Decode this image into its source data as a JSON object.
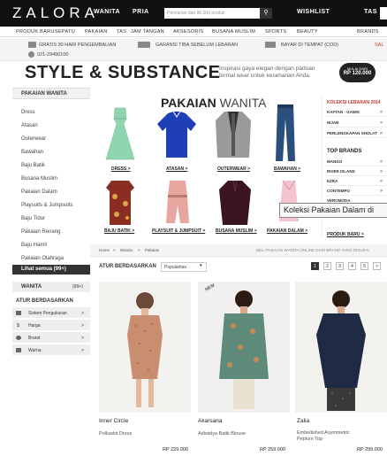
{
  "header": {
    "logo": "ZALORA",
    "nav": [
      "WANITA",
      "PRIA"
    ],
    "search_placeholder": "Pencarian dari 90.000 produk",
    "wishlist": "WISHLIST",
    "tas_short": "TAS"
  },
  "catnav": [
    "PRODUK BARU",
    "SEPATU",
    "PAKAIAN",
    "TAS",
    "JAM TANGAN",
    "AKSESORIS",
    "BUSANA MUSLIM",
    "SPORTS",
    "BEAUTY",
    "BRANDS"
  ],
  "benefits": {
    "free_return": "GRATIS 30 HARI PENGEMBALIAN",
    "phone": "021-29490100",
    "guarantee": "GARANSI TIBA SEBELUM LEBARAN",
    "cod": "BAYAR DI TEMPAT (COD)",
    "cut_right": "SAL"
  },
  "banner": {
    "title": "STYLE & SUBSTANCE",
    "subtitle": "Inspirasi gaya elegan dengan paduan formal wear untuk keseharian Anda.",
    "badge_top": "MULAI DARI",
    "badge_bottom": "RP 120.000"
  },
  "sidebar": {
    "heading": "PAKAIAN WANITA",
    "items": [
      "Dress",
      "Atasan",
      "Outerwear",
      "Bawahan",
      "Baju Batik",
      "Busana Muslim",
      "Pakaian Dalam",
      "Playsuits & Jumpsuits",
      "Baju Tidur",
      "Pakaian Renang",
      "Baju Hamil",
      "Pakaian Olahraga"
    ],
    "show_all": "Lihat semua (99+)",
    "wanita": "WANITA",
    "wanita_count": "(99+)",
    "filter_heading": "ATUR BERDASARKAN",
    "filters": [
      "Sistem Pengukuran",
      "Harga",
      "Brand",
      "Warna"
    ],
    "price_symbol": "$"
  },
  "main": {
    "title_bold": "PAKAIAN",
    "title_light": "WANITA",
    "categories": [
      "DRESS >",
      "ATASAN >",
      "OUTERWEAR >",
      "BAWAHAN >",
      "BAJU BATIK >",
      "PLAYSUIT & JUMPSUIT >",
      "BUSANA MUSLIM >",
      "PAKAIAN DALAM >"
    ],
    "tooltip": "Koleksi Pakaian Dalam di"
  },
  "right_panel": {
    "koleksi_title": "KOLEKSI LEBARAN 2014",
    "koleksi_links": [
      "KAFTAN - GAMIS",
      "HIJAB",
      "PERLENGKAPAN SHOLAT"
    ],
    "top_brands_title": "TOP BRANDS",
    "brands": [
      "MANGO",
      "RIVER ISLAND",
      "EZRA",
      "CONTEMPO",
      "VEROMODA"
    ],
    "produk_baru": "PRODUK BARU >",
    "arrow": ">"
  },
  "breadcrumb": {
    "items": [
      "Home",
      ">",
      "Wanita",
      ">",
      "Pakaian"
    ],
    "right_text": "BELI PAKAIAN WANITA ONLINE DARI BRAND YANG DISUKAI"
  },
  "sort": {
    "label": "ATUR BERDASARKAN",
    "value": "Popularitas",
    "caret": "▾",
    "pages": [
      "1",
      "2",
      "3",
      "4",
      "5",
      ">"
    ]
  },
  "products": [
    {
      "brand": "Inner Circle",
      "name": "Polkadot Dress",
      "price": "RP 229.000"
    },
    {
      "brand": "Akarsana",
      "name": "Adiwidya Batik Blouse",
      "price": "RP 259.000",
      "tag": "NEW"
    },
    {
      "brand": "Zalia",
      "name": "Embellished Asymmetric Peplum Top",
      "price": "RP 299.000"
    }
  ],
  "colors": {
    "topbar": "#111111",
    "dark": "#333333",
    "accent_red": "#c0392b",
    "dress_mint": "#8fd6b0",
    "polo_blue": "#1f3fb8",
    "badge": "#222222"
  }
}
